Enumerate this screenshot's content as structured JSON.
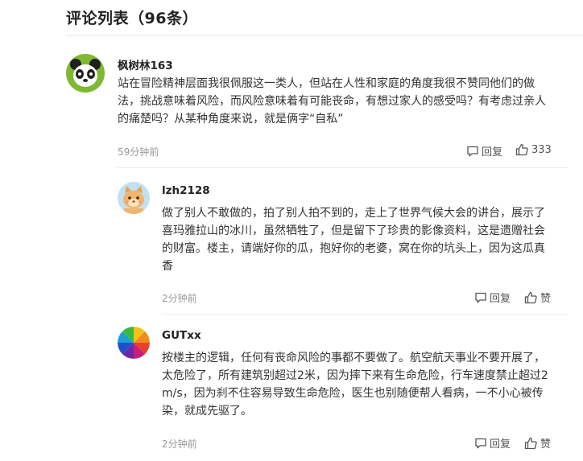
{
  "header": {
    "title": "评论列表（96条）"
  },
  "comments": [
    {
      "username": "枫树林163",
      "avatar": "panda-avatar",
      "lines": [
        "站在冒险精神层面我很佩服这一类人，但站在人性和家庭的角度我很不赞同他们的做",
        "法，挑战意味着风险，而风险意味着有可能丧命，有想过家人的感受吗？有考虑过亲人",
        "的痛楚吗？从某种角度来说，就是俩字“自私”"
      ],
      "time": "59分钟前",
      "reply_label": "回复",
      "like_label": "333"
    },
    {
      "username": "lzh2128",
      "avatar": "cat-avatar",
      "lines": [
        "做了别人不敢做的，拍了别人拍不到的，走上了世界气候大会的讲台，展示了",
        "喜玛雅拉山的冰川，虽然牺牲了，但是留下了珍贵的影像资料，这是遗赠社会",
        "的财富。楼主，请端好你的瓜，抱好你的老婆，窝在你的坑头上，因为这瓜真",
        "香"
      ],
      "time": "2分钟前",
      "reply_label": "回复",
      "like_label": "赞"
    },
    {
      "username": "GUTxx",
      "avatar": "color-wheel-avatar",
      "lines": [
        "按楼主的逻辑，任何有丧命风险的事都不要做了。航空航天事业不要开展了，",
        "太危险了，所有建筑别超过2米，因为摔下来有生命危险，行车速度禁止超过2",
        "m/s，因为刹不住容易导致生命危险，医生也别随便帮人看病，一不小心被传",
        "染，就成先驱了。"
      ],
      "time": "2分钟前",
      "reply_label": "回复",
      "like_label": "赞"
    }
  ]
}
